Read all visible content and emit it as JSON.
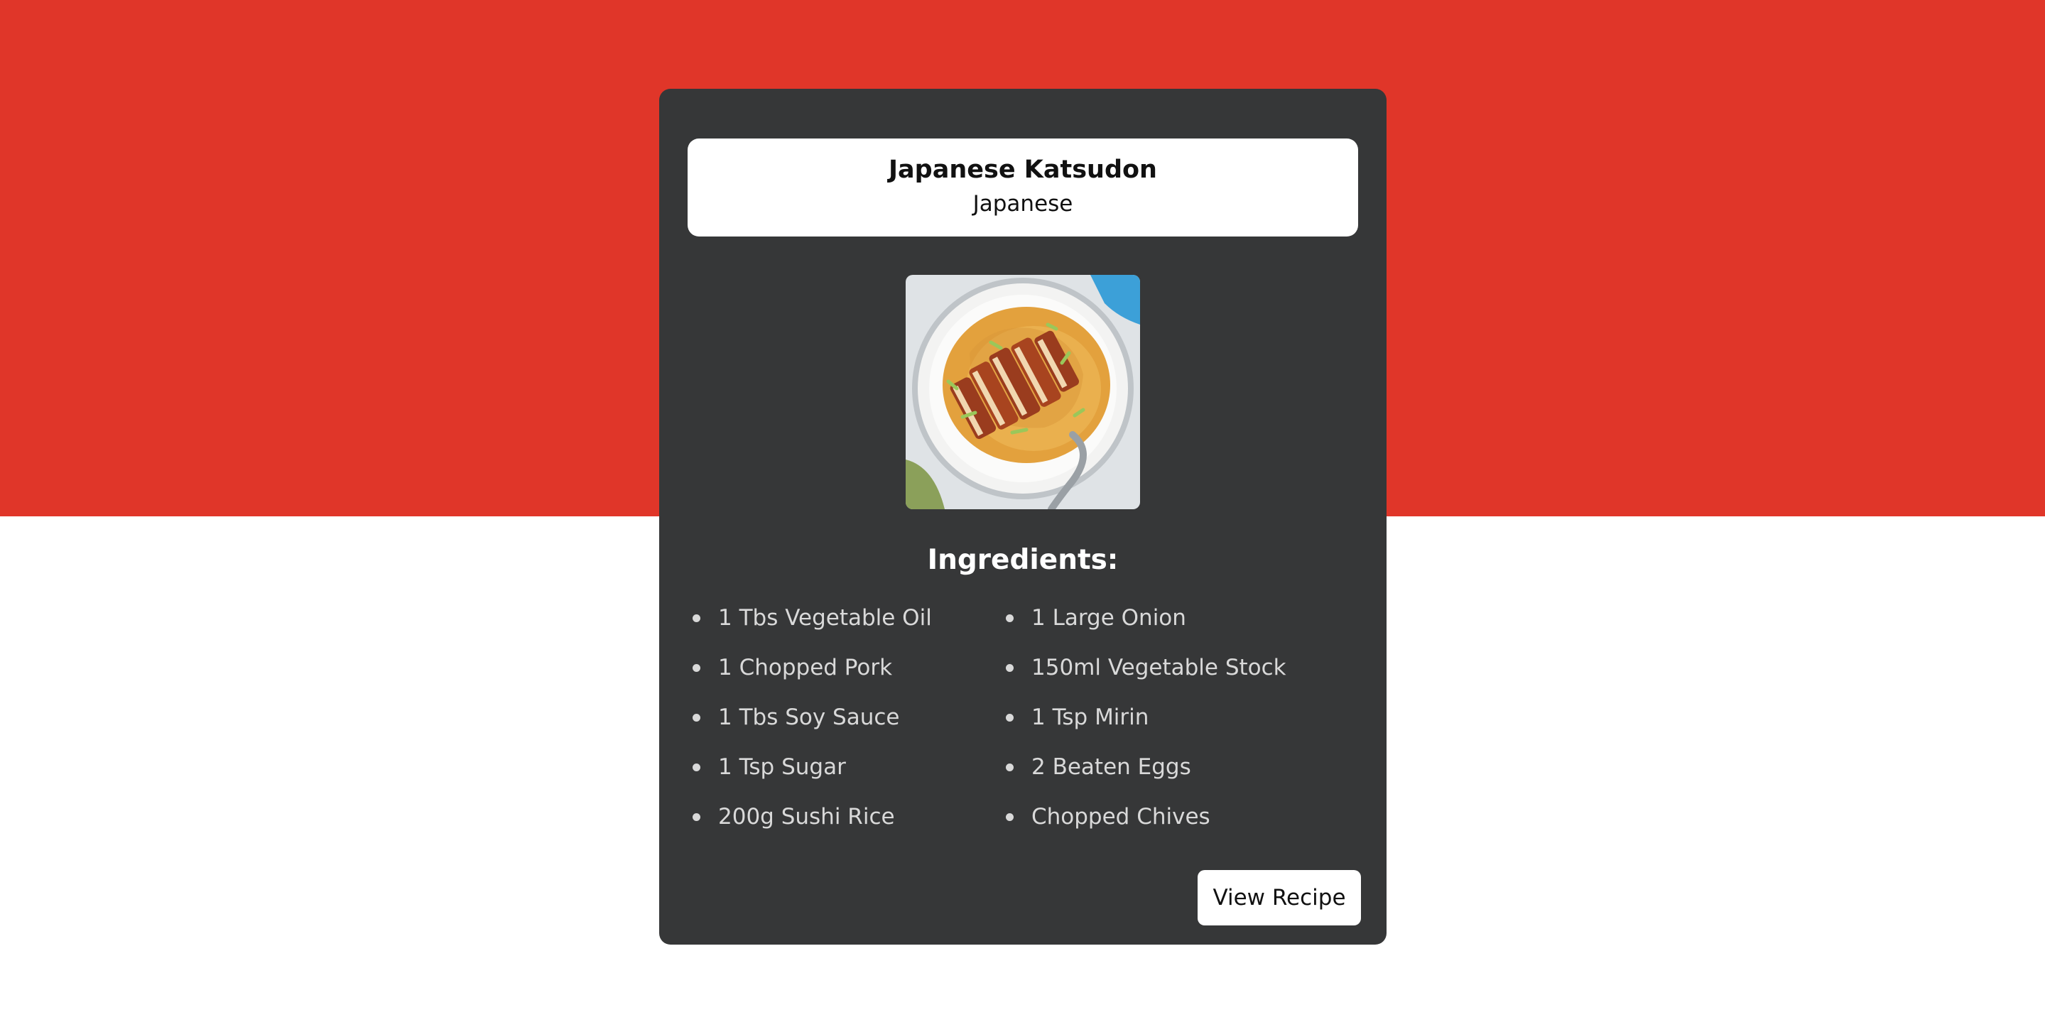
{
  "recipe": {
    "title": "Japanese Katsudon",
    "cuisine": "Japanese",
    "image_alt": "Japanese Katsudon"
  },
  "ingredients_heading": "Ingredients:",
  "ingredients_left": [
    "1 Tbs Vegetable Oil",
    "1 Chopped Pork",
    "1 Tbs Soy Sauce",
    "1 Tsp Sugar",
    "200g Sushi Rice"
  ],
  "ingredients_right": [
    "1 Large Onion",
    "150ml Vegetable Stock",
    "1 Tsp Mirin",
    "2 Beaten Eggs",
    "Chopped Chives"
  ],
  "actions": {
    "view_recipe_label": "View Recipe"
  },
  "colors": {
    "top_background": "#e03629",
    "bottom_background": "#ffffff",
    "card_background": "#363738",
    "text_light": "#d9d9d9"
  }
}
